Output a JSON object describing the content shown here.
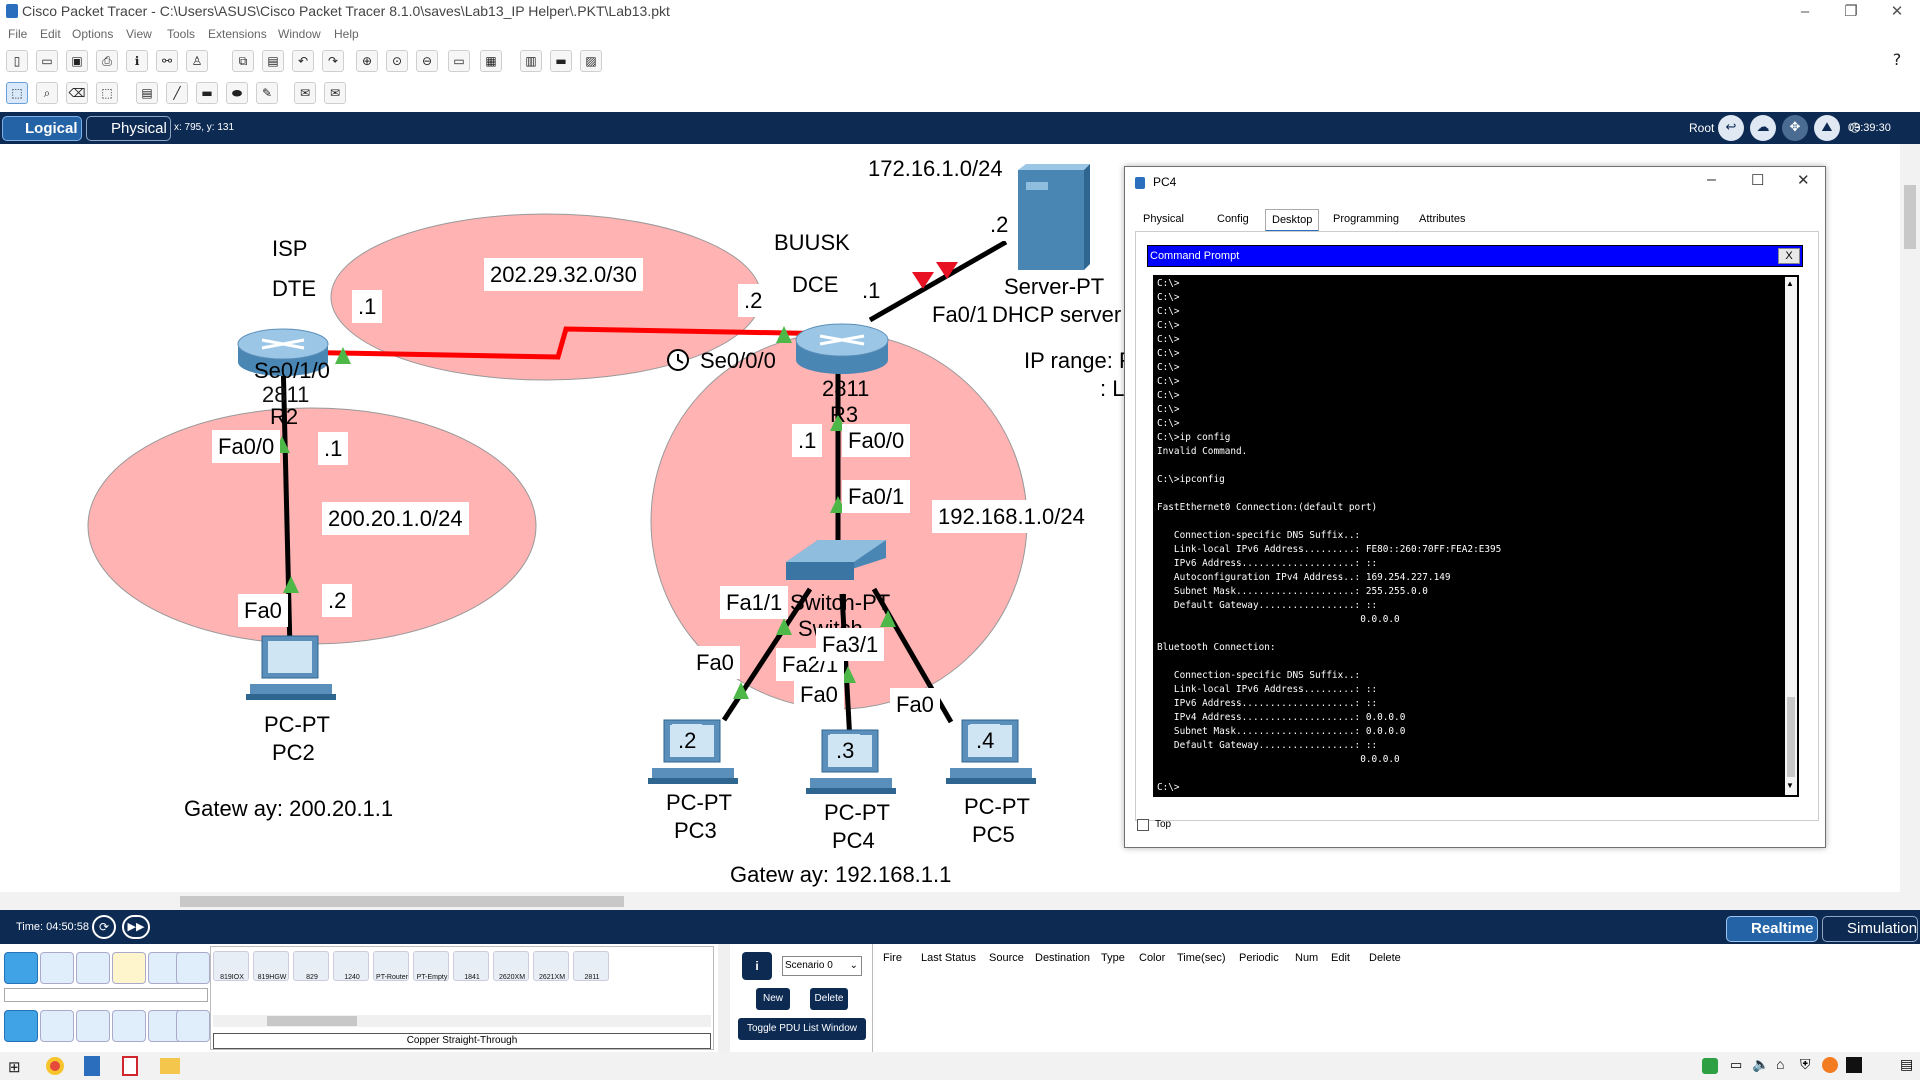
{
  "app": {
    "title": "Cisco Packet Tracer - C:\\Users\\ASUS\\Cisco Packet Tracer 8.1.0\\saves\\Lab13_IP Helper\\.PKT\\Lab13.pkt",
    "window_buttons": [
      "–",
      "❐",
      "✕"
    ]
  },
  "menu": [
    "File",
    "Edit",
    "Options",
    "View",
    "Tools",
    "Extensions",
    "Window",
    "Help"
  ],
  "mode_bar": {
    "logical": "Logical",
    "physical": "Physical",
    "coords": "x: 795, y: 131",
    "root": "Root",
    "time": "03:39:30"
  },
  "topology": {
    "networks": [
      {
        "label": "202.29.32.0/30"
      },
      {
        "label": "200.20.1.0/24"
      },
      {
        "label": "192.168.1.0/24"
      },
      {
        "label": "172.16.1.0/24"
      }
    ],
    "labels": {
      "isp": "ISP",
      "dte": "DTE",
      "isp_dot1": ".1",
      "isp_se": "Se0/1/0",
      "isp_model": "2811",
      "isp_name": "R2",
      "isp_fa00": "Fa0/0",
      "isp_fa_dot1": ".1",
      "buusk": "BUUSK",
      "dce": "DCE",
      "r3_dot2": ".2",
      "r3_dot1": ".1",
      "r3_se": "Se0/0/0",
      "r3_fa01": "Fa0/1",
      "r3_model": "2811",
      "r3_name": "R3",
      "r3_fa00_dot1": ".1",
      "r3_fa00": "Fa0/0",
      "sw_fa01": "Fa0/1",
      "sw_fa11": "Fa1/1",
      "sw_model": "Switch-PT",
      "sw_name": "Switch",
      "fa0_pc3": "Fa0",
      "fa2": "Fa2/1",
      "fa31": "Fa3/1",
      "fa0_pc4": "Fa0",
      "fa0_pc5": "Fa0",
      "server_dot2": ".2",
      "server_type": "Server-PT",
      "server_name": "DHCP server",
      "ip_range_1": "IP range: F",
      "ip_range_2": ": L",
      "pc2_fa0": "Fa0",
      "pc2_dot2": ".2",
      "pc2_type": "PC-PT",
      "pc2_name": "PC2",
      "pc3_dot": ".2",
      "pc3_type": "PC-PT",
      "pc3_name": "PC3",
      "pc4_dot": ".3",
      "pc4_type": "PC-PT",
      "pc4_name": "PC4",
      "pc5_dot": ".4",
      "pc5_type": "PC-PT",
      "pc5_name": "PC5",
      "gw_left": "Gatew ay: 200.20.1.1",
      "gw_right": "Gatew ay: 192.168.1.1"
    }
  },
  "pc4_window": {
    "title": "PC4",
    "tabs": [
      "Physical",
      "Config",
      "Desktop",
      "Programming",
      "Attributes"
    ],
    "active_tab": "Desktop",
    "cmd_title": "Command Prompt",
    "cmd_close": "X",
    "top_label": "Top",
    "cmd_lines": [
      "C:\\>",
      "C:\\>",
      "C:\\>",
      "C:\\>",
      "C:\\>",
      "C:\\>",
      "C:\\>",
      "C:\\>",
      "C:\\>",
      "C:\\>",
      "C:\\>",
      "C:\\>ip config",
      "Invalid Command.",
      "",
      "C:\\>ipconfig",
      "",
      "FastEthernet0 Connection:(default port)",
      "",
      "   Connection-specific DNS Suffix..:",
      "   Link-local IPv6 Address.........: FE80::260:70FF:FEA2:E395",
      "   IPv6 Address....................: ::",
      "   Autoconfiguration IPv4 Address..: 169.254.227.149",
      "   Subnet Mask.....................: 255.255.0.0",
      "   Default Gateway.................: ::",
      "                                    0.0.0.0",
      "",
      "Bluetooth Connection:",
      "",
      "   Connection-specific DNS Suffix..:",
      "   Link-local IPv6 Address.........: ::",
      "   IPv6 Address....................: ::",
      "   IPv4 Address....................: 0.0.0.0",
      "   Subnet Mask.....................: 0.0.0.0",
      "   Default Gateway.................: ::",
      "                                    0.0.0.0",
      "",
      "C:\\>"
    ]
  },
  "sim_bar": {
    "time": "Time: 04:50:58",
    "realtime": "Realtime",
    "simulation": "Simulation"
  },
  "device_models": [
    "819IOX",
    "819HGW",
    "829",
    "1240",
    "PT-Router",
    "PT-Empty",
    "1841",
    "2620XM",
    "2621XM",
    "2811"
  ],
  "cable_label": "Copper Straight-Through",
  "scenario": {
    "select": "Scenario 0",
    "info": "i",
    "new": "New",
    "delete": "Delete",
    "toggle": "Toggle PDU List Window"
  },
  "pdu_headers": [
    "Fire",
    "Last Status",
    "Source",
    "Destination",
    "Type",
    "Color",
    "Time(sec)",
    "Periodic",
    "Num",
    "Edit",
    "Delete"
  ],
  "colors": {
    "network_fill": "#ffb3b3",
    "serial": "#ff0000",
    "mode_bar": "#0d2a52",
    "cmd_title": "#0000ff"
  }
}
